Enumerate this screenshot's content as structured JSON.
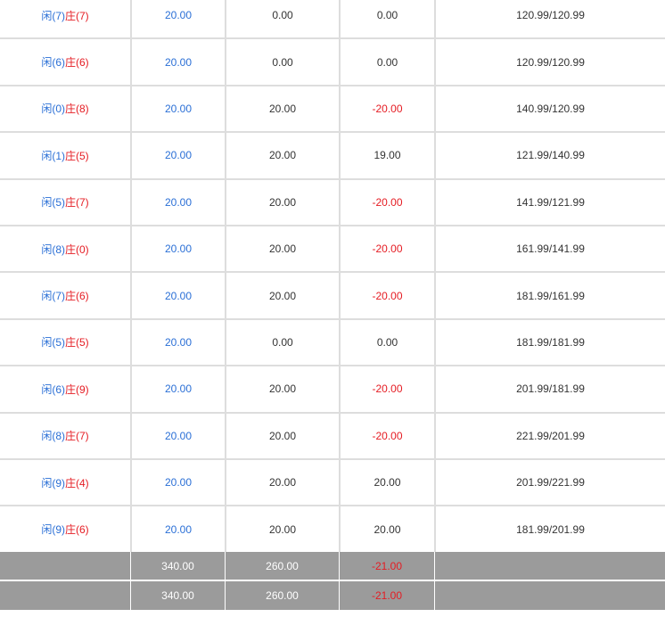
{
  "colors": {
    "player": "#2a6fd6",
    "banker": "#e51c23",
    "negative": "#e51c23",
    "stake": "#2a6fd6",
    "total_row_bg": "#9b9b9b"
  },
  "rows": [
    {
      "player": "闲(7)",
      "banker": "庄(7)",
      "stake": "20.00",
      "valid": "0.00",
      "win_loss": "0.00",
      "balance": "120.99/120.99",
      "negative": false
    },
    {
      "player": "闲(6)",
      "banker": "庄(6)",
      "stake": "20.00",
      "valid": "0.00",
      "win_loss": "0.00",
      "balance": "120.99/120.99",
      "negative": false
    },
    {
      "player": "闲(0)",
      "banker": "庄(8)",
      "stake": "20.00",
      "valid": "20.00",
      "win_loss": "-20.00",
      "balance": "140.99/120.99",
      "negative": true
    },
    {
      "player": "闲(1)",
      "banker": "庄(5)",
      "stake": "20.00",
      "valid": "20.00",
      "win_loss": "19.00",
      "balance": "121.99/140.99",
      "negative": false
    },
    {
      "player": "闲(5)",
      "banker": "庄(7)",
      "stake": "20.00",
      "valid": "20.00",
      "win_loss": "-20.00",
      "balance": "141.99/121.99",
      "negative": true
    },
    {
      "player": "闲(8)",
      "banker": "庄(0)",
      "stake": "20.00",
      "valid": "20.00",
      "win_loss": "-20.00",
      "balance": "161.99/141.99",
      "negative": true
    },
    {
      "player": "闲(7)",
      "banker": "庄(6)",
      "stake": "20.00",
      "valid": "20.00",
      "win_loss": "-20.00",
      "balance": "181.99/161.99",
      "negative": true
    },
    {
      "player": "闲(5)",
      "banker": "庄(5)",
      "stake": "20.00",
      "valid": "0.00",
      "win_loss": "0.00",
      "balance": "181.99/181.99",
      "negative": false
    },
    {
      "player": "闲(6)",
      "banker": "庄(9)",
      "stake": "20.00",
      "valid": "20.00",
      "win_loss": "-20.00",
      "balance": "201.99/181.99",
      "negative": true
    },
    {
      "player": "闲(8)",
      "banker": "庄(7)",
      "stake": "20.00",
      "valid": "20.00",
      "win_loss": "-20.00",
      "balance": "221.99/201.99",
      "negative": true
    },
    {
      "player": "闲(9)",
      "banker": "庄(4)",
      "stake": "20.00",
      "valid": "20.00",
      "win_loss": "20.00",
      "balance": "201.99/221.99",
      "negative": false
    },
    {
      "player": "闲(9)",
      "banker": "庄(6)",
      "stake": "20.00",
      "valid": "20.00",
      "win_loss": "20.00",
      "balance": "181.99/201.99",
      "negative": false
    }
  ],
  "totals": [
    {
      "stake": "340.00",
      "valid": "260.00",
      "win_loss": "-21.00"
    },
    {
      "stake": "340.00",
      "valid": "260.00",
      "win_loss": "-21.00"
    }
  ]
}
